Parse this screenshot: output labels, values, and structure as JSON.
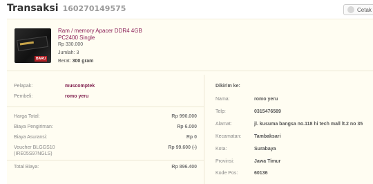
{
  "header": {
    "title": "Transaksi",
    "invoice_number": "160270149575",
    "print_label": "Cetak b"
  },
  "product": {
    "badge": "BARU",
    "name": "Ram / memory Apacer DDR4 4GB PC2400 Single",
    "price": "Rp 330.000",
    "quantity": "Jumlah: 3",
    "weight_label": "Berat:",
    "weight_value": "300 gram"
  },
  "parties": {
    "seller_label": "Pelapak:",
    "seller": "muscomptek",
    "buyer_label": "Pembeli:",
    "buyer": "romo yeru"
  },
  "costs": {
    "total_price_label": "Harga Total:",
    "total_price": "Rp 990.000",
    "shipping_label": "Biaya Pengiriman:",
    "shipping": "Rp 6.000",
    "insurance_label": "Biaya Asuransi:",
    "insurance": "Rp 0",
    "voucher_label": "Voucher BLGGS10 (IRE05S97NGLS)",
    "voucher": "Rp 99.600 (-)",
    "grand_total_label": "Total Biaya:",
    "grand_total": "Rp 896.400"
  },
  "shipping": {
    "heading": "Dikirim ke:",
    "name_label": "Nama:",
    "name": "romo yeru",
    "phone_label": "Telp:",
    "phone": "0315476589",
    "address_label": "Alamat:",
    "address": "jl. kusuma bangsa no.118 hi tech mall lt.2 no 35",
    "district_label": "Kecamatan:",
    "district": "Tambaksari",
    "city_label": "Kota:",
    "city": "Surabaya",
    "province_label": "Provinsi:",
    "province": "Jawa Timur",
    "postal_label": "Kode Pos:",
    "postal": "60136"
  }
}
